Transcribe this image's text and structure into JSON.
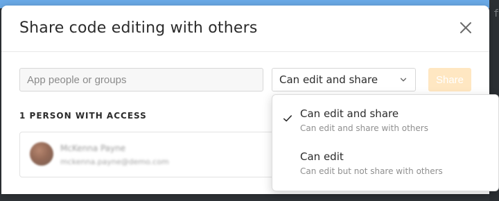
{
  "modal": {
    "title": "Share code editing with others"
  },
  "share_row": {
    "search_placeholder": "App people or groups",
    "selected_permission": "Can edit and share",
    "share_button_label": "Share"
  },
  "access": {
    "section_label": "1 PERSON WITH ACCESS",
    "people": [
      {
        "name": "McKenna Payne",
        "email": "mckenna.payne@demo.com"
      }
    ]
  },
  "permission_dropdown": {
    "options": [
      {
        "label": "Can edit and share",
        "description": "Can edit and share with others",
        "selected": true
      },
      {
        "label": "Can edit",
        "description": "Can edit but not share with others",
        "selected": false
      }
    ]
  },
  "colors": {
    "share_button_bg": "#ffe7c2",
    "top_strip": "#6aa9e6"
  },
  "icons": {
    "close": "close-icon",
    "dropdown_chevron": "chevron-down-icon",
    "selected_check": "checkmark-icon"
  },
  "background": {
    "editor_glyph": "f"
  }
}
